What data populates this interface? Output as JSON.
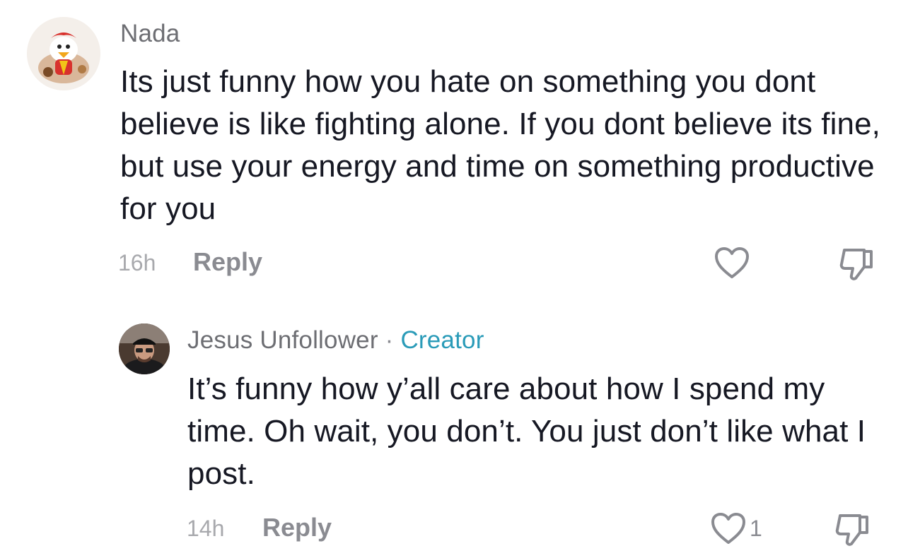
{
  "comments": [
    {
      "username": "Nada",
      "text": "Its just funny how you hate on something you dont believe is like fighting alone. If you dont believe its fine, but use your energy and time on something productive for you",
      "time": "16h",
      "reply_label": "Reply",
      "avatar_icon": "cartoon-duck-avatar",
      "heart_icon": "heart-outline-icon",
      "dislike_icon": "thumbs-down-outline-icon"
    },
    {
      "username": "Jesus Unfollower",
      "separator": "·",
      "badge": "Creator",
      "text": "It’s funny how y’all care about how I spend my time. Oh wait, you don’t. You just don’t like what I post.",
      "time": "14h",
      "reply_label": "Reply",
      "like_count": "1",
      "avatar_icon": "man-photo-avatar",
      "heart_icon": "heart-outline-icon",
      "dislike_icon": "thumbs-down-outline-icon"
    }
  ],
  "colors": {
    "text": "#161823",
    "username": "#6d6e73",
    "meta": "#a8a9ad",
    "reply": "#8a8b91",
    "creator_badge": "#2a9bb8"
  }
}
